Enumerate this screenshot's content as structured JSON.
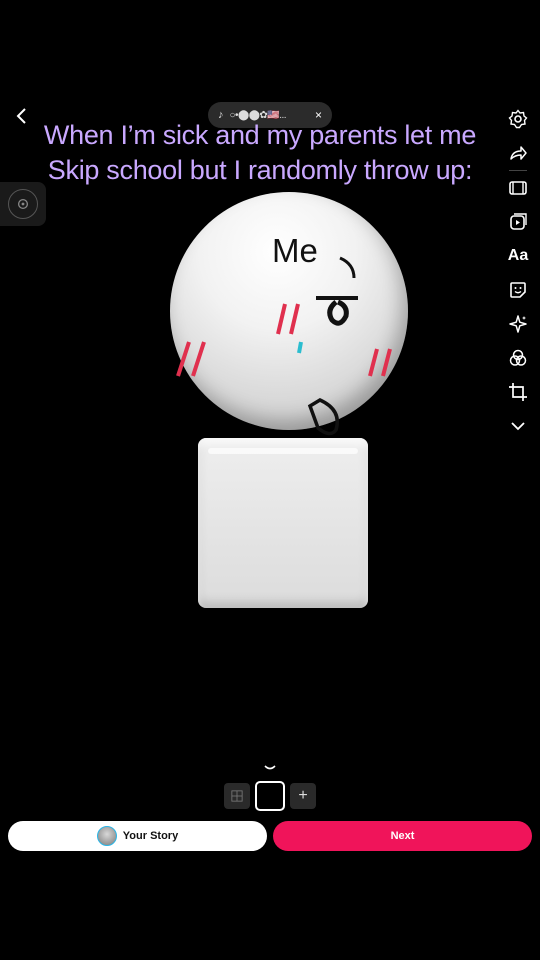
{
  "header": {
    "music_title": "○•⬤⬤✿🇺🇸...",
    "close_symbol": "×"
  },
  "caption": {
    "line1": "When I’m sick and my parents let me",
    "line2": "Skip school but I randomly throw up:"
  },
  "canvas": {
    "label": "Me"
  },
  "frames": {
    "add_symbol": "+"
  },
  "footer": {
    "story_label": "Your Story",
    "next_label": "Next"
  },
  "colors": {
    "caption": "#c9a8ff",
    "next_button": "#f0145a",
    "blush": "#e0304e",
    "tear": "#2bbdcf"
  }
}
